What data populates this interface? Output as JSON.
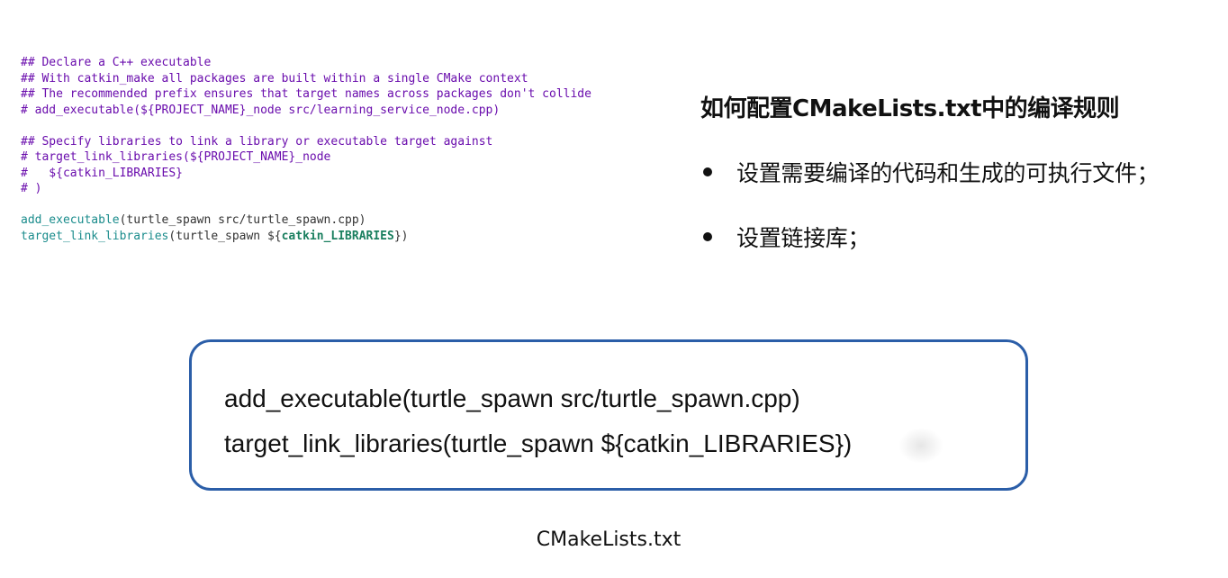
{
  "code": {
    "block1": [
      "## Declare a C++ executable",
      "## With catkin_make all packages are built within a single CMake context",
      "## The recommended prefix ensures that target names across packages don't collide",
      "# add_executable(${PROJECT_NAME}_node src/learning_service_node.cpp)"
    ],
    "block2": [
      "## Specify libraries to link a library or executable target against",
      "# target_link_libraries(${PROJECT_NAME}_node",
      "#   ${catkin_LIBRARIES}",
      "# )"
    ],
    "line_add_func": "add_executable",
    "line_add_args": "(turtle_spawn src/turtle_spawn.cpp)",
    "line_link_func": "target_link_libraries",
    "line_link_args_pre": "(turtle_spawn ${",
    "line_link_var": "catkin_LIBRARIES",
    "line_link_args_post": "})"
  },
  "right": {
    "title": "如何配置CMakeLists.txt中的编译规则",
    "bullets": [
      "设置需要编译的代码和生成的可执行文件；",
      "设置链接库；"
    ]
  },
  "box": {
    "line1": "add_executable(turtle_spawn src/turtle_spawn.cpp)",
    "line2": "target_link_libraries(turtle_spawn ${catkin_LIBRARIES})"
  },
  "caption": "CMakeLists.txt",
  "colors": {
    "comment": "#6a0dad",
    "function": "#1a8c8c",
    "variable": "#1a7f5f",
    "box_border": "#2b5ea8"
  }
}
